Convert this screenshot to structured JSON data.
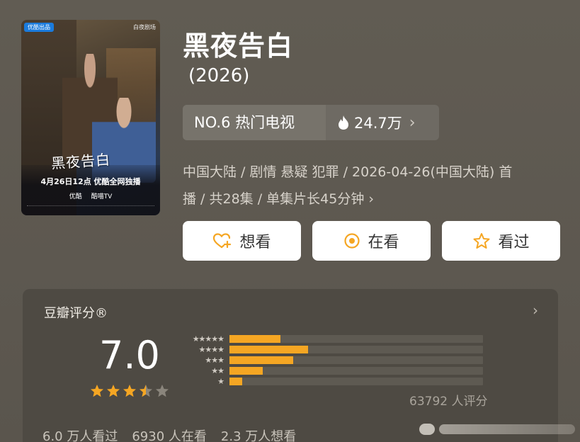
{
  "poster": {
    "badge": "优酷出品",
    "brand": "白夜剧场",
    "calligraphy": "黑夜告白",
    "release": "4月26日12点 优酷全网独播",
    "platforms": [
      "优酷",
      "酷喵TV"
    ]
  },
  "title": "黑夜告白",
  "year": "(2026)",
  "rank": {
    "label": "NO.6 热门电视",
    "heat": "24.7万",
    "chevron": "›"
  },
  "meta": {
    "line1": "中国大陆 / 剧情 悬疑 犯罪 / 2026-04-26(中国大陆) 首",
    "line2": "播 / 共28集 / 单集片长45分钟",
    "chevron": "›"
  },
  "actions": [
    {
      "label": "想看",
      "icon": "heart-plus-icon"
    },
    {
      "label": "在看",
      "icon": "target-circle-icon"
    },
    {
      "label": "看过",
      "icon": "star-outline-icon"
    }
  ],
  "rating": {
    "title": "豆瓣评分®",
    "score": "7.0",
    "stars": 3.5,
    "count": "63792 人评分",
    "distribution": [
      {
        "stars": 5,
        "fraction": 0.2
      },
      {
        "stars": 4,
        "fraction": 0.31
      },
      {
        "stars": 3,
        "fraction": 0.25
      },
      {
        "stars": 2,
        "fraction": 0.13
      },
      {
        "stars": 1,
        "fraction": 0.05
      }
    ]
  },
  "stats": [
    "6.0 万人看过",
    "6930 人在看",
    "2.3 万人想看"
  ],
  "colors": {
    "background": "#5e5950",
    "accent": "#f5a623",
    "card": "#4e4a43"
  }
}
